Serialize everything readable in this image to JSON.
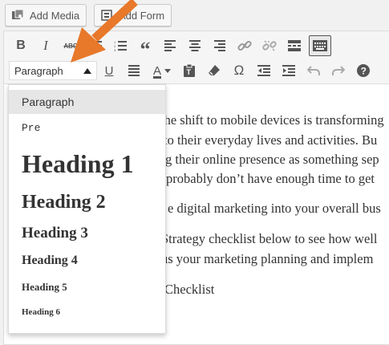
{
  "media_buttons": {
    "add_media": "Add Media",
    "add_form": "Add Form"
  },
  "toolbar": {
    "format_select": "Paragraph",
    "row1_icons": [
      "bold-icon",
      "italic-icon",
      "strikethrough-icon",
      "bulleted-list-icon",
      "numbered-list-icon",
      "blockquote-icon",
      "align-left-icon",
      "align-center-icon",
      "align-right-icon",
      "insert-link-icon",
      "remove-link-icon",
      "read-more-icon",
      "toolbar-toggle-icon"
    ],
    "row2_icons": [
      "underline-icon",
      "justify-icon",
      "text-color-icon",
      "paste-as-text-icon",
      "clear-formatting-icon",
      "special-character-icon",
      "outdent-icon",
      "indent-icon",
      "undo-icon",
      "redo-icon",
      "help-icon"
    ]
  },
  "format_menu": {
    "items": [
      "Paragraph",
      "Pre",
      "Heading 1",
      "Heading 2",
      "Heading 3",
      "Heading 4",
      "Heading 5",
      "Heading 6"
    ],
    "selected": "Paragraph"
  },
  "content": {
    "lines": [
      "the shift to mobile devices is transforming",
      "to their everyday lives and activities.  Bu",
      "g their online presence as something sep",
      "probably don’t have enough time to get",
      "e digital marketing into your overall bus",
      "Strategy checklist below to see how well",
      "us your marketing planning and implem",
      "Checklist"
    ]
  },
  "colors": {
    "annotation_arrow": "#e8782a",
    "menu_selected_bg": "#e6e6e6"
  }
}
